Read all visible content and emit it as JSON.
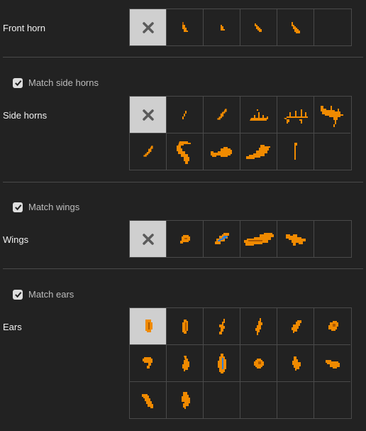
{
  "sections": {
    "front_horn": {
      "label": "Front horn"
    },
    "side_horns": {
      "match_label": "Match side horns",
      "match_checked": true,
      "label": "Side horns"
    },
    "wings": {
      "match_label": "Match wings",
      "match_checked": true,
      "label": "Wings"
    },
    "ears": {
      "match_label": "Match ears",
      "match_checked": true,
      "label": "Ears"
    }
  },
  "colors": {
    "background": "#222222",
    "border": "#4a4a4a",
    "selected_cell": "#cfcfcf",
    "sprite_orange": "#f08a00",
    "sprite_dark": "#b05a00",
    "sprite_blue": "#2f7fd8",
    "none_icon": "#5a5a5a"
  },
  "icons": {
    "none": "x-icon",
    "checkbox": "checkmark-icon"
  }
}
